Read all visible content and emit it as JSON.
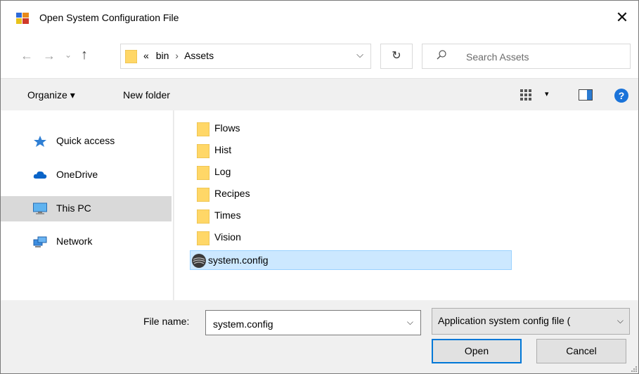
{
  "window": {
    "title": "Open System Configuration File",
    "close_glyph": "✕"
  },
  "address": {
    "overflow_glyph": "«",
    "crumbs": [
      "bin",
      "Assets"
    ],
    "separator": "›",
    "dropdown_glyph": "⌵",
    "refresh_glyph": "↻"
  },
  "nav_buttons": {
    "back": "←",
    "forward": "→",
    "recent": "⌄",
    "up": "↑"
  },
  "search": {
    "placeholder": "Search Assets",
    "value": ""
  },
  "toolbar": {
    "organize_label": "Organize ▾",
    "new_folder_label": "New folder",
    "views_drop": "▾",
    "help": "?"
  },
  "sidebar": {
    "items": [
      {
        "label": "Quick access",
        "icon": "star-pin-icon",
        "selected": false
      },
      {
        "label": "OneDrive",
        "icon": "cloud-icon",
        "selected": false
      },
      {
        "label": "This PC",
        "icon": "computer-icon",
        "selected": true
      },
      {
        "label": "Network",
        "icon": "network-icon",
        "selected": false
      }
    ]
  },
  "files": [
    {
      "name": "Flows",
      "type": "folder"
    },
    {
      "name": "Hist",
      "type": "folder"
    },
    {
      "name": "Log",
      "type": "folder"
    },
    {
      "name": "Recipes",
      "type": "folder"
    },
    {
      "name": "Times",
      "type": "folder"
    },
    {
      "name": "Vision",
      "type": "folder"
    },
    {
      "name": "system.config",
      "type": "file",
      "selected": true
    }
  ],
  "bottom": {
    "file_name_label": "File name:",
    "file_name_value": "system.config",
    "filter_text": "Application system config file (",
    "open_label": "Open",
    "cancel_label": "Cancel"
  },
  "colors": {
    "selection_bg": "#cce8ff",
    "selection_border": "#99d1ff",
    "folder_yellow": "#ffd767",
    "accent_blue": "#0078d7",
    "help_blue": "#1a73d9"
  }
}
